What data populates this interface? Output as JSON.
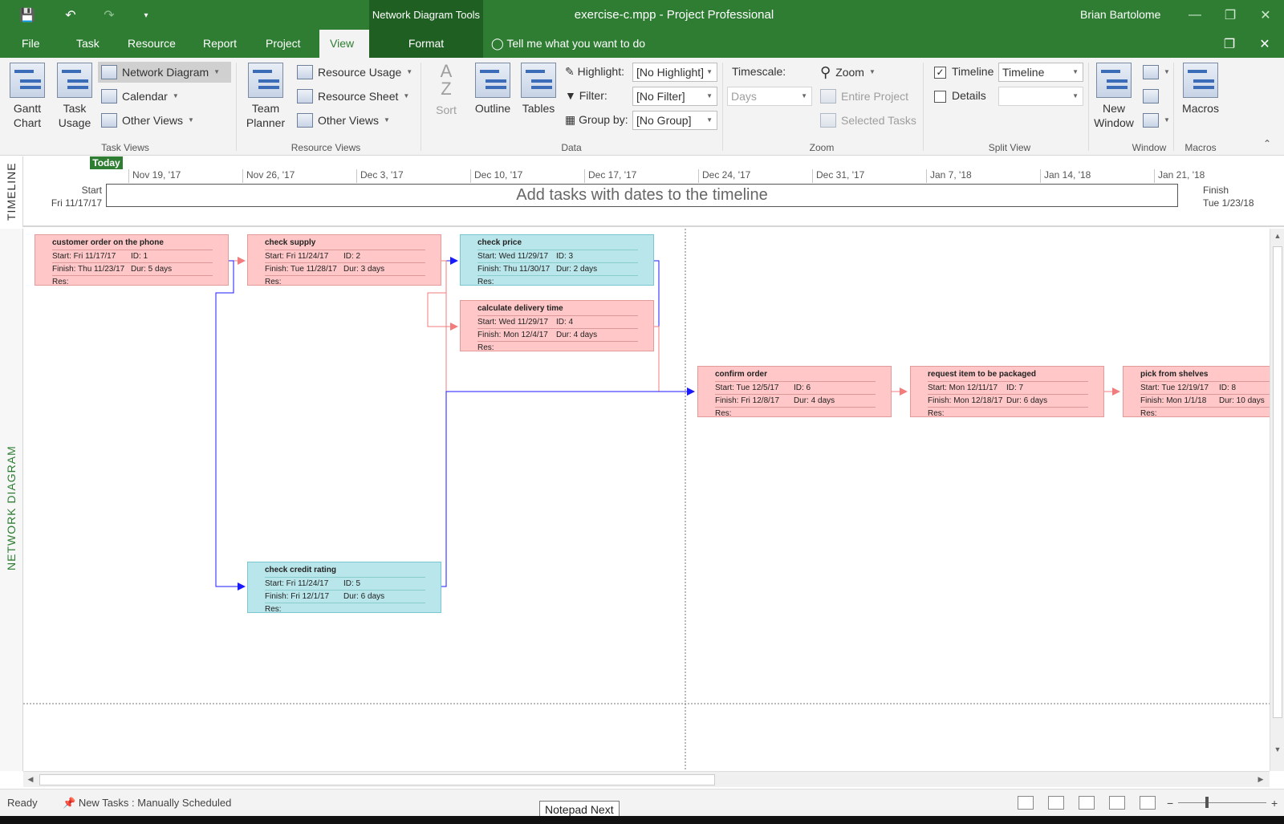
{
  "titlebar": {
    "context_group": "Network Diagram Tools",
    "title": "exercise-c.mpp  -  Project Professional",
    "user": "Brian Bartolome"
  },
  "tabs": [
    {
      "label": "File"
    },
    {
      "label": "Task"
    },
    {
      "label": "Resource"
    },
    {
      "label": "Report"
    },
    {
      "label": "Project"
    },
    {
      "label": "View"
    },
    {
      "label": "Format"
    }
  ],
  "tell_me": "Tell me what you want to do",
  "ribbon": {
    "task_views": {
      "gantt": "Gantt Chart",
      "task_usage": "Task Usage",
      "network_diagram": "Network Diagram",
      "calendar": "Calendar",
      "other_views": "Other Views",
      "label": "Task Views"
    },
    "resource_views": {
      "team_planner": "Team Planner",
      "resource_usage": "Resource Usage",
      "resource_sheet": "Resource Sheet",
      "other_views": "Other Views",
      "label": "Resource Views"
    },
    "data": {
      "sort": "Sort",
      "outline": "Outline",
      "tables": "Tables",
      "highlight_label": "Highlight:",
      "highlight_value": "[No Highlight]",
      "filter_label": "Filter:",
      "filter_value": "[No Filter]",
      "group_label": "Group by:",
      "group_value": "[No Group]",
      "label": "Data"
    },
    "zoom": {
      "timescale_label": "Timescale:",
      "timescale_value": "Days",
      "zoom": "Zoom",
      "entire_project": "Entire Project",
      "selected_tasks": "Selected Tasks",
      "label": "Zoom"
    },
    "split_view": {
      "timeline_label": "Timeline",
      "timeline_checked": true,
      "timeline_value": "Timeline",
      "details_label": "Details",
      "details_checked": false,
      "label": "Split View"
    },
    "window": {
      "new_window": "New Window",
      "label": "Window"
    },
    "macros": {
      "macros": "Macros",
      "label": "Macros"
    }
  },
  "timeline": {
    "side_label": "TIMELINE",
    "today": "Today",
    "ticks": [
      "Nov 19, '17",
      "Nov 26, '17",
      "Dec 3, '17",
      "Dec 10, '17",
      "Dec 17, '17",
      "Dec 24, '17",
      "Dec 31, '17",
      "Jan 7, '18",
      "Jan 14, '18",
      "Jan 21, '18"
    ],
    "placeholder": "Add tasks with dates to the timeline",
    "start_label": "Start",
    "start_date": "Fri 11/17/17",
    "finish_label": "Finish",
    "finish_date": "Tue 1/23/18"
  },
  "network": {
    "side_label": "NETWORK DIAGRAM",
    "nodes": [
      {
        "name": "customer order on the phone",
        "start": "Start:  Fri 11/17/17",
        "id": "ID:  1",
        "finish": "Finish: Thu 11/23/17",
        "dur": "Dur: 5 days",
        "res": "Res:",
        "critical": true
      },
      {
        "name": "check supply",
        "start": "Start:  Fri 11/24/17",
        "id": "ID:  2",
        "finish": "Finish: Tue 11/28/17",
        "dur": "Dur: 3 days",
        "res": "Res:",
        "critical": true
      },
      {
        "name": "check price",
        "start": "Start:  Wed 11/29/17",
        "id": "ID:  3",
        "finish": "Finish: Thu 11/30/17",
        "dur": "Dur: 2 days",
        "res": "Res:",
        "critical": false
      },
      {
        "name": "calculate delivery time",
        "start": "Start:  Wed 11/29/17",
        "id": "ID:  4",
        "finish": "Finish: Mon 12/4/17",
        "dur": "Dur: 4 days",
        "res": "Res:",
        "critical": true
      },
      {
        "name": "check credit rating",
        "start": "Start:  Fri 11/24/17",
        "id": "ID:  5",
        "finish": "Finish: Fri 12/1/17",
        "dur": "Dur: 6 days",
        "res": "Res:",
        "critical": false
      },
      {
        "name": "confirm order",
        "start": "Start:  Tue 12/5/17",
        "id": "ID:  6",
        "finish": "Finish: Fri 12/8/17",
        "dur": "Dur: 4 days",
        "res": "Res:",
        "critical": true
      },
      {
        "name": "request item to be packaged",
        "start": "Start:  Mon 12/11/17",
        "id": "ID:  7",
        "finish": "Finish: Mon 12/18/17",
        "dur": "Dur: 6 days",
        "res": "Res:",
        "critical": true
      },
      {
        "name": "pick from shelves",
        "start": "Start:  Tue 12/19/17",
        "id": "ID:  8",
        "finish": "Finish: Mon 1/1/18",
        "dur": "Dur: 10 days",
        "res": "Res:",
        "critical": true
      }
    ]
  },
  "status": {
    "ready": "Ready",
    "new_tasks": "New Tasks : Manually Scheduled"
  },
  "tooltip": "Notepad Next",
  "colors": {
    "brand": "#2e7d32",
    "critical_node": "#ffc7c7",
    "noncritical_node": "#b9e6ea",
    "critical_link": "#f27b7b",
    "noncritical_link": "#1a1aff"
  }
}
